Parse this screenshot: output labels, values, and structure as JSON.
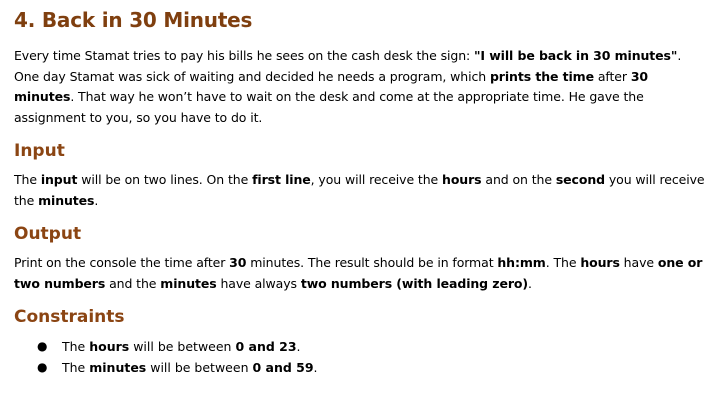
{
  "title": "4. Back in 30 Minutes",
  "intro": {
    "t1": "Every time Stamat tries to pay his bills he sees on the cash desk the sign: ",
    "b1": "\"I will be back in 30 minutes\"",
    "t2": ". One day Stamat was sick of waiting and decided he needs a program, which ",
    "b2": "prints the time",
    "t3": " after ",
    "b3": "30 minutes",
    "t4": ". That way he won’t have to wait on the desk and come at the appropriate time. He gave the assignment to you, so you have to do it."
  },
  "input": {
    "heading": "Input",
    "t1": "The ",
    "b1": "input",
    "t2": " will be on two lines. On the ",
    "b2": "first line",
    "t3": ", you will receive the ",
    "b3": "hours",
    "t4": " and on the ",
    "b4": "second",
    "t5": " you will receive the ",
    "b5": "minutes",
    "t6": "."
  },
  "output": {
    "heading": "Output",
    "t1": "Print on the console the time after ",
    "b1": "30",
    "t2": " minutes. The result should be in format ",
    "b2": "hh:mm",
    "t3": ". The ",
    "b3": "hours",
    "t4": " have ",
    "b4": "one or two numbers",
    "t5": " and the ",
    "b5": "minutes",
    "t6": " have always ",
    "b6": "two numbers (with leading zero)",
    "t7": "."
  },
  "constraints": {
    "heading": "Constraints",
    "items": [
      {
        "t1": "The ",
        "b1": "hours",
        "t2": " will be between ",
        "b2": "0 and 23",
        "t3": "."
      },
      {
        "t1": "The ",
        "b1": "minutes",
        "t2": " will be between ",
        "b2": "0 and 59",
        "t3": "."
      }
    ]
  }
}
